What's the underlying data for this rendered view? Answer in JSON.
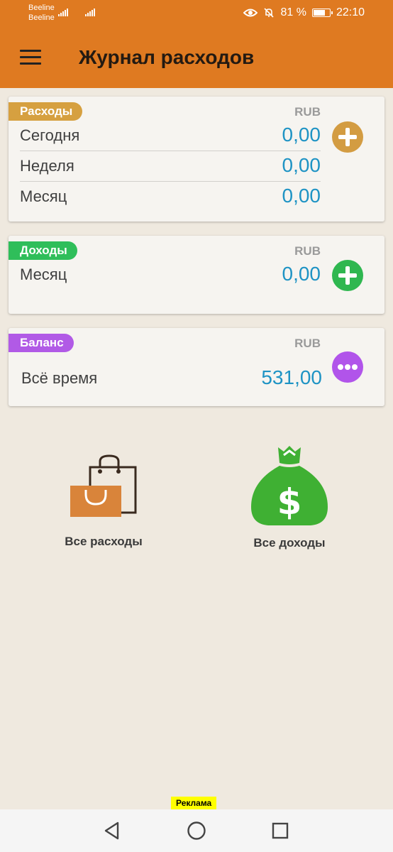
{
  "status_bar": {
    "carrier_1": "Beeline",
    "carrier_2": "Beeline",
    "battery": "81 %",
    "battery_level": 0.81,
    "time": "22:10"
  },
  "app_bar": {
    "title": "Журнал расходов",
    "color": "#df7a21"
  },
  "expenses": {
    "tag": "Расходы",
    "tag_color": "#d6a040",
    "currency": "RUB",
    "rows": [
      {
        "label": "Сегодня",
        "value": "0,00"
      },
      {
        "label": "Неделя",
        "value": "0,00"
      },
      {
        "label": "Месяц",
        "value": "0,00"
      }
    ],
    "button_icon": "add-icon",
    "button_color": "#d39c42"
  },
  "income": {
    "tag": "Доходы",
    "tag_color": "#2fbe5a",
    "currency": "RUB",
    "rows": [
      {
        "label": "Месяц",
        "value": "0,00"
      }
    ],
    "button_icon": "add-icon",
    "button_color": "#2fb750"
  },
  "balance": {
    "tag": "Баланс",
    "tag_color": "#b15ae6",
    "currency": "RUB",
    "rows": [
      {
        "label": "Всё время",
        "value": "531,00"
      }
    ],
    "button_icon": "more-icon",
    "button_color": "#b154ea"
  },
  "shortcuts": {
    "all_expenses": "Все расходы",
    "all_income": "Все доходы"
  },
  "ad_label": "Реклама",
  "nav": {
    "back_icon": "back-triangle-icon",
    "home_icon": "home-circle-icon",
    "recents_icon": "recents-square-icon"
  }
}
